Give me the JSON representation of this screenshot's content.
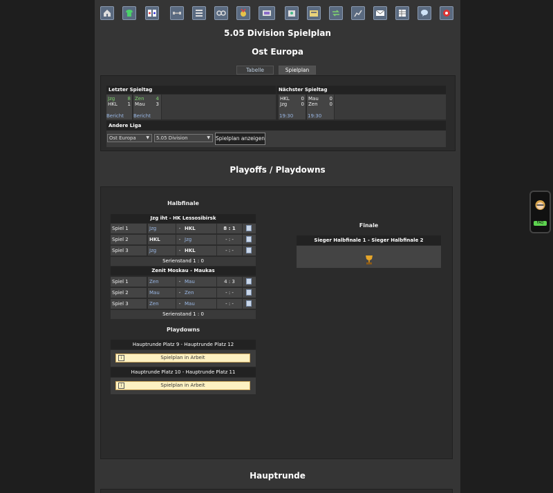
{
  "nav": {
    "icons": [
      "home-icon",
      "jersey-icon",
      "cards-icon",
      "training-icon",
      "list-icon",
      "glasses-icon",
      "medal-icon",
      "arena-icon",
      "academy-icon",
      "news-icon",
      "transfer-icon",
      "stats-icon",
      "mail-icon",
      "table-icon",
      "chat-icon",
      "logout-icon"
    ]
  },
  "page": {
    "title": "5.05 Division Spielplan",
    "subtitle": "Ost Europa"
  },
  "tabs": [
    {
      "label": "Tabelle"
    },
    {
      "label": "Spielplan"
    }
  ],
  "last_matchday": {
    "header": "Letzter Spieltag",
    "matches": [
      {
        "home": "Jzg",
        "home_score": "8",
        "away": "HKL",
        "away_score": "1",
        "report": "Bericht"
      },
      {
        "home": "Zen",
        "home_score": "4",
        "away": "Mau",
        "away_score": "3",
        "report": "Bericht"
      }
    ]
  },
  "next_matchday": {
    "header": "Nächster Spieltag",
    "matches": [
      {
        "home": "HKL",
        "home_score": "0",
        "away": "Jzg",
        "away_score": "0",
        "time": "19:30"
      },
      {
        "home": "Mau",
        "home_score": "0",
        "away": "Zen",
        "away_score": "0",
        "time": "19:30"
      }
    ]
  },
  "other_league": {
    "header": "Andere Liga",
    "region": "Ost Europa",
    "division": "5.05 Division",
    "button": "Spielplan anzeigen"
  },
  "playoffs": {
    "title": "Playoffs / Playdowns",
    "semifinal_title": "Halbfinale",
    "series": [
      {
        "title": "Jzg iht - HK Lessosibirsk",
        "games": [
          {
            "label": "Spiel 1",
            "home": "Jzg",
            "sep": "-",
            "away": "HKL",
            "score": "8 : 1"
          },
          {
            "label": "Spiel 2",
            "home": "HKL",
            "sep": "-",
            "away": "Jzg",
            "score": "- : -"
          },
          {
            "label": "Spiel 3",
            "home": "Jzg",
            "sep": "-",
            "away": "HKL",
            "score": "- : -"
          }
        ],
        "standing": "Serienstand 1 : 0"
      },
      {
        "title": "Zenit Moskau - Maukas",
        "games": [
          {
            "label": "Spiel 1",
            "home": "Zen",
            "sep": "-",
            "away": "Mau",
            "score": "4 : 3"
          },
          {
            "label": "Spiel 2",
            "home": "Mau",
            "sep": "-",
            "away": "Zen",
            "score": "- : -"
          },
          {
            "label": "Spiel 3",
            "home": "Zen",
            "sep": "-",
            "away": "Mau",
            "score": "- : -"
          }
        ],
        "standing": "Serienstand 1 : 0"
      }
    ],
    "playdowns_title": "Playdowns",
    "playdowns": [
      {
        "title": "Hauptrunde Platz 9 - Hauptrunde Platz 12",
        "note": "Spielplan in Arbeit",
        "info": "i"
      },
      {
        "title": "Hauptrunde Platz 10 - Hauptrunde Platz 11",
        "note": "Spielplan in Arbeit",
        "info": "i"
      }
    ],
    "final_title": "Finale",
    "final_match": "Sieger Halbfinale 1 - Sieger Halbfinale 2"
  },
  "hauptrunde": {
    "title": "Hauptrunde"
  },
  "phone_badge": "FAQ"
}
